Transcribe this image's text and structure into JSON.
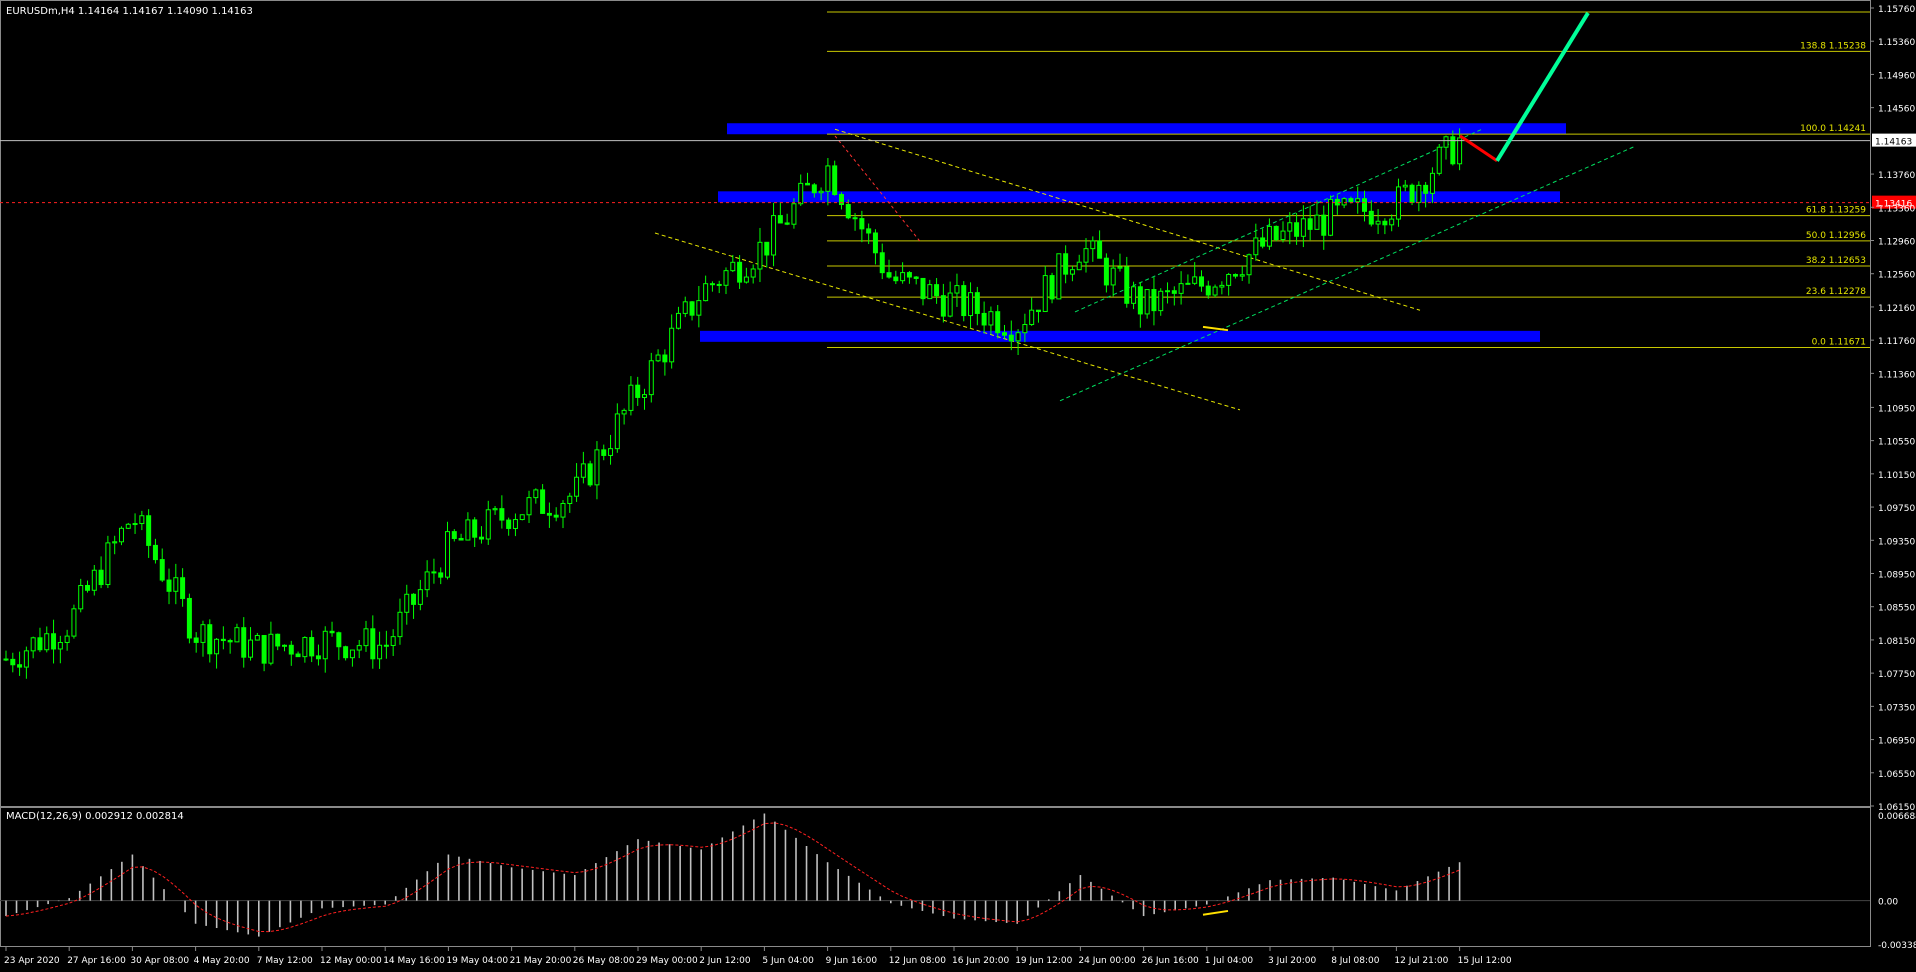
{
  "header": {
    "symbol_info": "EURUSDm,H4  1.14164 1.14167 1.14090 1.14163",
    "indicator_info": "MACD(12,26,9) 0.002912 0.002814"
  },
  "price_axis": {
    "labels": [
      "1.15760",
      "1.15360",
      "1.14960",
      "1.14560",
      "1.14163",
      "1.13760",
      "1.13416",
      "1.13360",
      "1.12960",
      "1.12560",
      "1.12160",
      "1.11760",
      "1.11360",
      "1.10950",
      "1.10550",
      "1.10150",
      "1.09750",
      "1.09350",
      "1.08950",
      "1.08550",
      "1.08150",
      "1.07750",
      "1.07350",
      "1.06950",
      "1.06550",
      "1.06150"
    ],
    "current_price": "1.14163",
    "marked_price": "1.13416"
  },
  "macd_axis": {
    "labels": [
      "0.006684",
      "0.00",
      "-0.00338"
    ]
  },
  "time_axis": {
    "labels": [
      "23 Apr 2020",
      "27 Apr 16:00",
      "30 Apr 08:00",
      "4 May 20:00",
      "7 May 12:00",
      "12 May 00:00",
      "14 May 16:00",
      "19 May 04:00",
      "21 May 20:00",
      "26 May 08:00",
      "29 May 00:00",
      "2 Jun 12:00",
      "5 Jun 04:00",
      "9 Jun 16:00",
      "12 Jun 08:00",
      "16 Jun 20:00",
      "19 Jun 12:00",
      "24 Jun 00:00",
      "26 Jun 16:00",
      "1 Jul 04:00",
      "3 Jul 20:00",
      "8 Jul 08:00",
      "12 Jul 21:00",
      "15 Jul 12:00"
    ]
  },
  "fibonacci_levels": [
    {
      "label": "138.8 1.15238",
      "price": 1.15238
    },
    {
      "label": "100.0 1.14241",
      "price": 1.14241
    },
    {
      "label": "61.8 1.13259",
      "price": 1.13259
    },
    {
      "label": "50.0 1.12956",
      "price": 1.12956
    },
    {
      "label": "38.2 1.12653",
      "price": 1.12653
    },
    {
      "label": "23.6 1.12278",
      "price": 1.12278
    },
    {
      "label": "0.0 1.11671",
      "price": 1.11671
    }
  ],
  "colors": {
    "background": "#000000",
    "bull_candle": "#00ff00",
    "bear_candle": "#00ff00",
    "fibo": "#c8c800",
    "zone": "#0000ff",
    "trend_green": "#00e060",
    "trend_yellow": "#e6e600",
    "arrow_up": "#00ff99",
    "arrow_down": "#ff0000",
    "macd_hist": "#c0c0c0",
    "macd_signal": "#ff2020"
  },
  "chart_data": {
    "type": "candlestick",
    "title": "EURUSDm,H4",
    "ylim": [
      1.0615,
      1.1576
    ],
    "price_path": [
      [
        "23 Apr 2020",
        1.0792
      ],
      [
        "27 Apr 16:00",
        1.0835
      ],
      [
        "30 Apr 08:00",
        1.0965
      ],
      [
        "4 May 20:00",
        1.0825
      ],
      [
        "7 May 12:00",
        1.0805
      ],
      [
        "12 May 00:00",
        1.0815
      ],
      [
        "14 May 16:00",
        1.0808
      ],
      [
        "19 May 04:00",
        1.0925
      ],
      [
        "21 May 20:00",
        1.097
      ],
      [
        "26 May 08:00",
        1.099
      ],
      [
        "29 May 00:00",
        1.1115
      ],
      [
        "2 Jun 12:00",
        1.1235
      ],
      [
        "5 Jun 04:00",
        1.129
      ],
      [
        "9 Jun 16:00",
        1.1385
      ],
      [
        "12 Jun 08:00",
        1.125
      ],
      [
        "16 Jun 20:00",
        1.1222
      ],
      [
        "19 Jun 12:00",
        1.1195
      ],
      [
        "24 Jun 00:00",
        1.129
      ],
      [
        "26 Jun 16:00",
        1.1215
      ],
      [
        "1 Jul 04:00",
        1.1245
      ],
      [
        "3 Jul 20:00",
        1.1295
      ],
      [
        "8 Jul 08:00",
        1.1325
      ],
      [
        "12 Jul 21:00",
        1.134
      ],
      [
        "15 Jul 12:00",
        1.1416
      ]
    ],
    "macd_hist_path": [
      [
        "23 Apr 2020",
        -0.0012
      ],
      [
        "27 Apr 16:00",
        0.0002
      ],
      [
        "30 Apr 08:00",
        0.0036
      ],
      [
        "4 May 20:00",
        -0.0018
      ],
      [
        "7 May 12:00",
        -0.0028
      ],
      [
        "12 May 00:00",
        -0.0006
      ],
      [
        "14 May 16:00",
        -0.0003
      ],
      [
        "19 May 04:00",
        0.0036
      ],
      [
        "21 May 20:00",
        0.0026
      ],
      [
        "26 May 08:00",
        0.002
      ],
      [
        "29 May 00:00",
        0.0048
      ],
      [
        "2 Jun 12:00",
        0.004
      ],
      [
        "5 Jun 04:00",
        0.0068
      ],
      [
        "9 Jun 16:00",
        0.003
      ],
      [
        "12 Jun 08:00",
        -0.0002
      ],
      [
        "16 Jun 20:00",
        -0.0014
      ],
      [
        "19 Jun 12:00",
        -0.0018
      ],
      [
        "24 Jun 00:00",
        0.002
      ],
      [
        "26 Jun 16:00",
        -0.0012
      ],
      [
        "1 Jul 04:00",
        -0.0003
      ],
      [
        "3 Jul 20:00",
        0.0016
      ],
      [
        "8 Jul 08:00",
        0.0018
      ],
      [
        "12 Jul 21:00",
        0.0008
      ],
      [
        "15 Jul 12:00",
        0.003
      ]
    ],
    "current_price": 1.14163,
    "marked_price": 1.13416,
    "support_resistance_zones": [
      1.143,
      1.1348,
      1.118
    ],
    "macd": {
      "main": 0.002912,
      "signal": 0.002814,
      "ylim": [
        -0.00338,
        0.006684
      ]
    }
  }
}
